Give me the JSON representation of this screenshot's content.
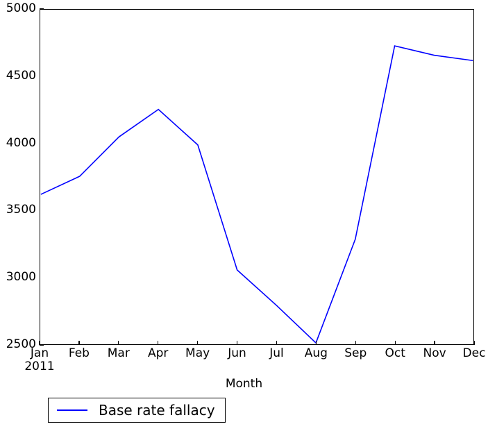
{
  "chart_data": {
    "type": "line",
    "title": "",
    "xlabel": "Month",
    "ylabel": "",
    "categories": [
      "Jan",
      "Feb",
      "Mar",
      "Apr",
      "May",
      "Jun",
      "Jul",
      "Aug",
      "Sep",
      "Oct",
      "Nov",
      "Dec"
    ],
    "x_sublabels": [
      "2011",
      "",
      "",
      "",
      "",
      "",
      "",
      "",
      "",
      "",
      "",
      ""
    ],
    "series": [
      {
        "name": "Base rate fallacy",
        "color": "#0000ff",
        "values": [
          3620,
          3755,
          4050,
          4255,
          3990,
          3055,
          2790,
          2510,
          3285,
          4730,
          4660,
          4620
        ]
      }
    ],
    "xlim": [
      0,
      11
    ],
    "ylim": [
      2500,
      5000
    ],
    "yticks": [
      2500,
      3000,
      3500,
      4000,
      4500,
      5000
    ],
    "ytick_labels": [
      "2500",
      "3000",
      "3500",
      "4000",
      "4500",
      "5000"
    ],
    "grid": false,
    "legend_position": "below-axes-left"
  },
  "legend": {
    "entries": [
      {
        "label": "Base rate fallacy",
        "color": "#0000ff"
      }
    ]
  },
  "axes": {
    "x_title": "Month"
  },
  "colors": {
    "series_blue": "#0000ff",
    "axis_black": "#000000",
    "background": "#ffffff"
  }
}
